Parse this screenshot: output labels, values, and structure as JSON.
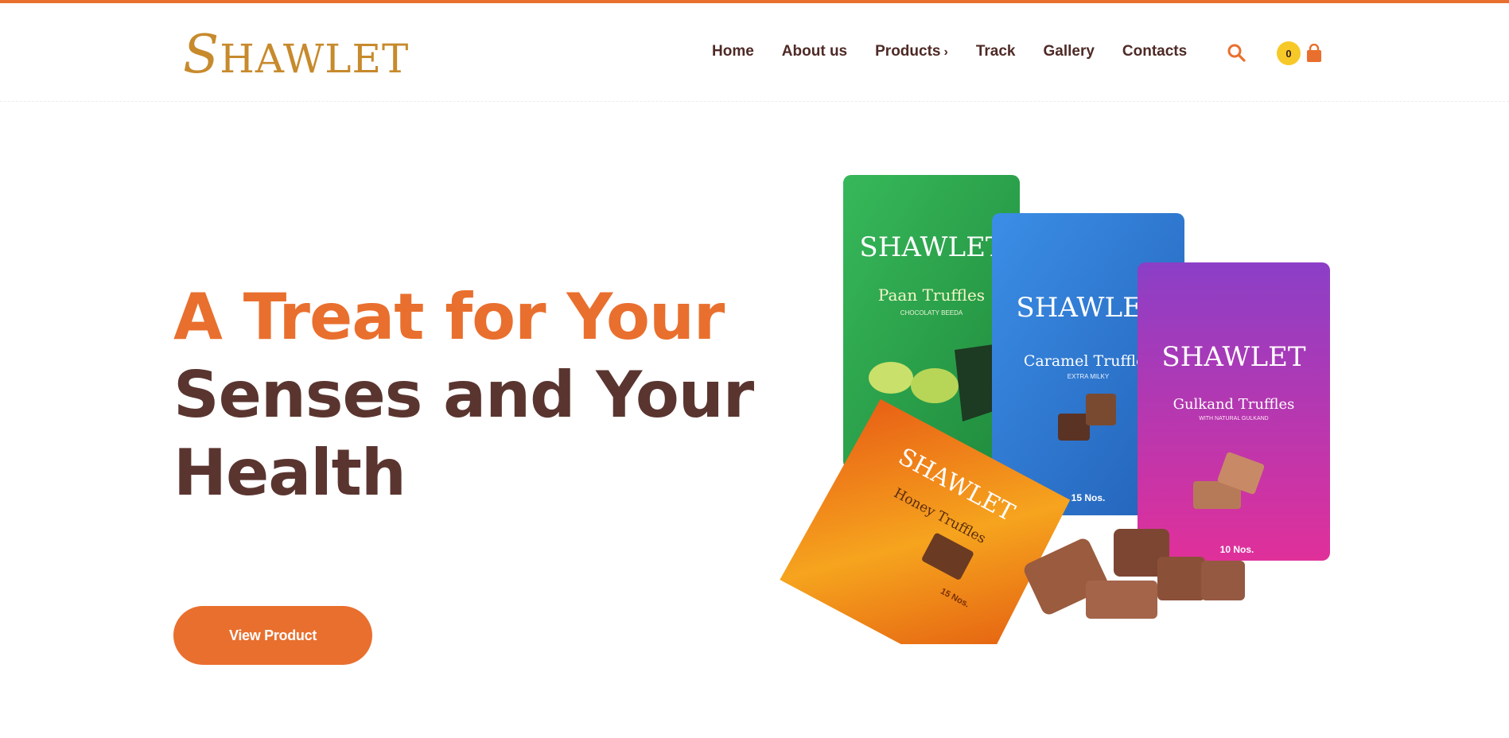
{
  "brand": {
    "name": "SHAWLET",
    "color": "#c78a2c"
  },
  "colors": {
    "accent": "#e96f2e",
    "dark": "#5a3530",
    "badge": "#f6c928"
  },
  "nav": {
    "items": [
      {
        "label": "Home"
      },
      {
        "label": "About us"
      },
      {
        "label": "Products",
        "has_submenu": true
      },
      {
        "label": "Track"
      },
      {
        "label": "Gallery"
      },
      {
        "label": "Contacts"
      }
    ],
    "submenu_icon": "chevron-right-icon"
  },
  "header_actions": {
    "search_icon": "search-icon",
    "cart_icon": "shopping-bag-icon",
    "cart_count": "0"
  },
  "hero": {
    "line1": "A Treat for Your",
    "line2": "Senses and Your",
    "line3": "Health",
    "cta_label": "View Product"
  },
  "products": [
    {
      "brand": "SHAWLET",
      "name": "Paan Truffles",
      "subtitle": "CHOCOLATY BEEDA",
      "color": "#2aa84a"
    },
    {
      "brand": "SHAWLET",
      "name": "Caramel Truffles",
      "subtitle": "EXTRA MILKY",
      "count": "15 Nos.",
      "color": "#2f7fd6"
    },
    {
      "brand": "SHAWLET",
      "name": "Gulkand Truffles",
      "subtitle": "WITH NATURAL GULKAND",
      "count": "10 Nos.",
      "color": "#c23bb8"
    },
    {
      "brand": "SHAWLET",
      "name": "Honey Truffles",
      "count": "15 Nos.",
      "color": "#ef8a1a"
    }
  ]
}
